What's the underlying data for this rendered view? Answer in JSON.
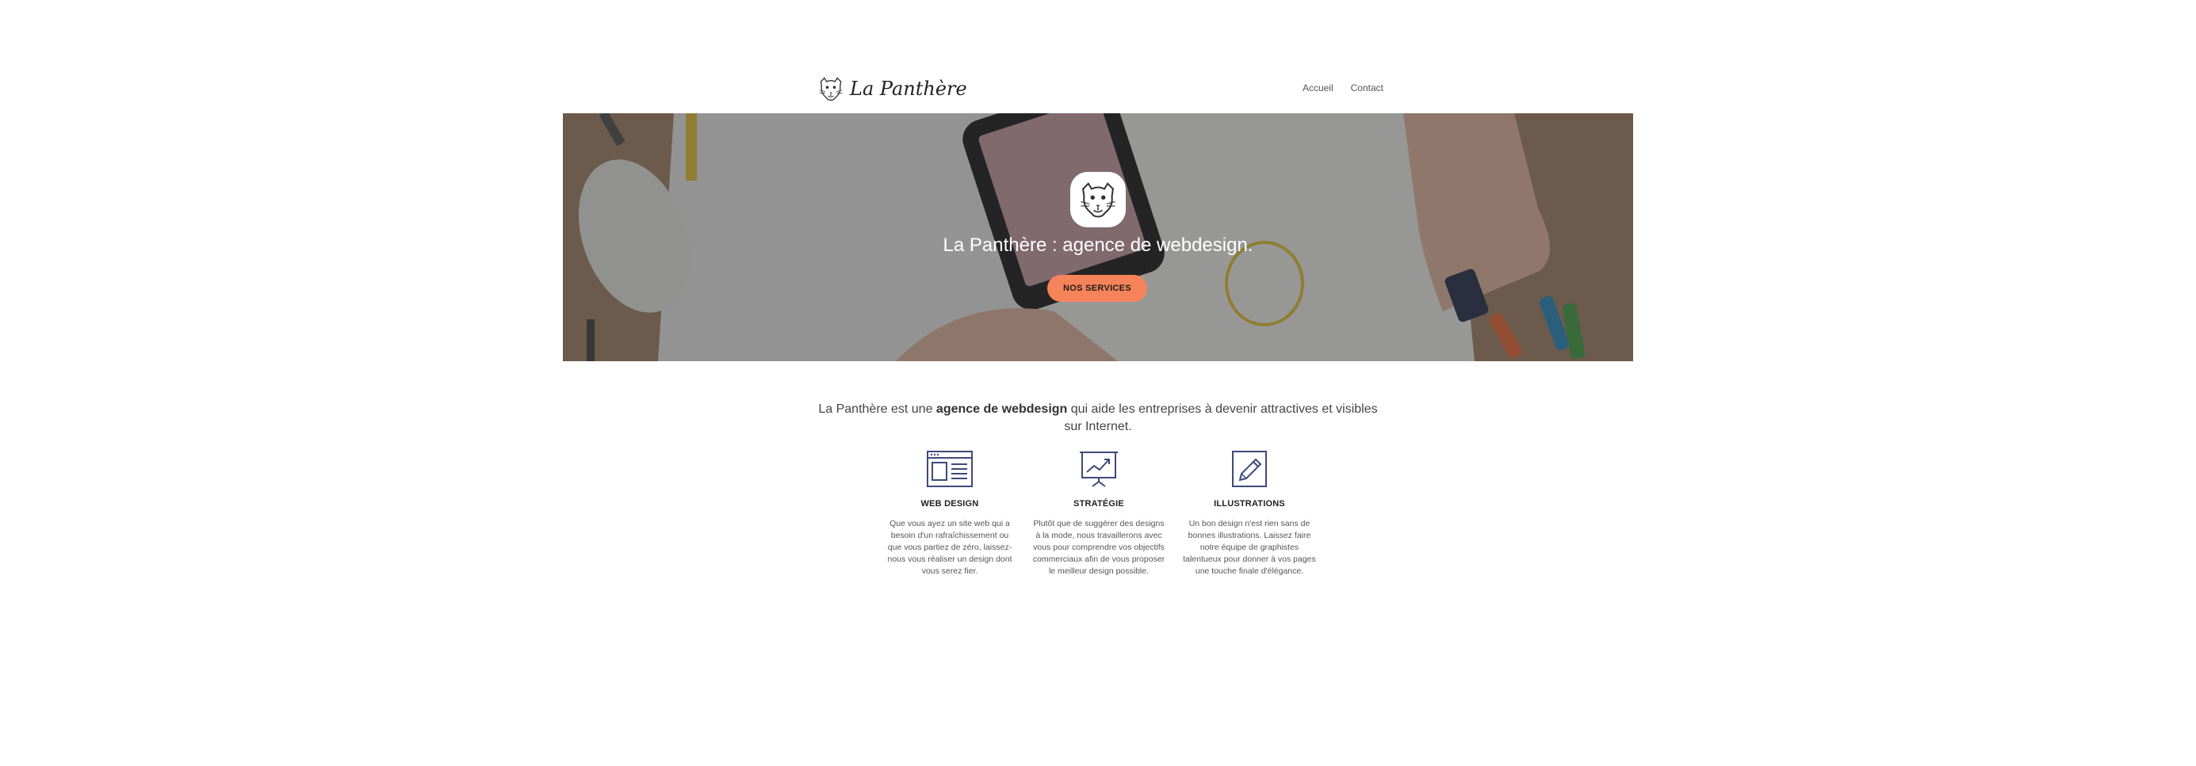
{
  "header": {
    "logo_text": "La Panthère",
    "nav": [
      {
        "label": "Accueil"
      },
      {
        "label": "Contact"
      }
    ]
  },
  "hero": {
    "title": "La Panthère : agence de webdesign.",
    "button_label": "NOS SERVICES",
    "button_color": "#f7835a"
  },
  "intro": {
    "before": "La Panthère est une ",
    "bold": "agence de webdesign",
    "after": " qui aide les entreprises à devenir attractives et visibles sur Internet."
  },
  "services": [
    {
      "icon": "browser-window-icon",
      "title": "WEB DESIGN",
      "description": "Que vous ayez un site web qui a besoin d'un rafraîchissement ou que vous partiez de zéro, laissez-nous vous réaliser un design dont vous serez fier."
    },
    {
      "icon": "presentation-chart-icon",
      "title": "STRATÉGIE",
      "description": "Plutôt que de suggérer des designs à la mode, nous travaillerons avec vous pour comprendre vos objectifs commerciaux afin de vous proposer le meilleur design possible."
    },
    {
      "icon": "pencil-icon",
      "title": "ILLUSTRATIONS",
      "description": "Un bon design n'est rien sans de bonnes illustrations. Laissez faire notre équipe de graphistes talentueux pour donner à vos pages une touche finale d'élégance."
    }
  ],
  "colors": {
    "accent": "#f7835a",
    "icon_stroke": "#3d4a7a",
    "text": "#444444"
  }
}
